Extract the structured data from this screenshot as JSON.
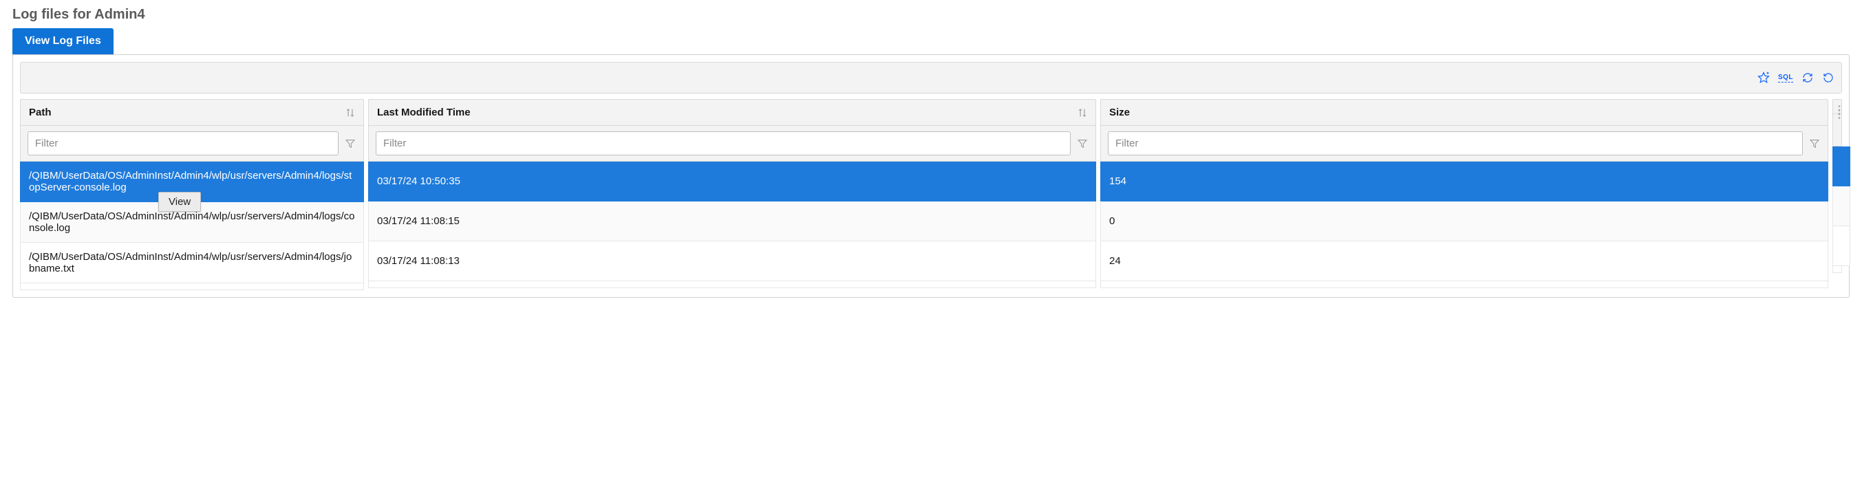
{
  "title": "Log files for Admin4",
  "tabs": {
    "viewLogFiles": "View Log Files"
  },
  "toolbar": {
    "sql": "SQL"
  },
  "columns": {
    "path": "Path",
    "time": "Last Modified Time",
    "size": "Size"
  },
  "filterPlaceholder": "Filter",
  "contextMenu": {
    "view": "View"
  },
  "rows": [
    {
      "path": "/QIBM/UserData/OS/AdminInst/Admin4/wlp/usr/servers/Admin4/logs/stopServer-console.log",
      "time": "03/17/24 10:50:35",
      "size": "154",
      "selected": true
    },
    {
      "path": "/QIBM/UserData/OS/AdminInst/Admin4/wlp/usr/servers/Admin4/logs/console.log",
      "time": "03/17/24 11:08:15",
      "size": "0",
      "selected": false
    },
    {
      "path": "/QIBM/UserData/OS/AdminInst/Admin4/wlp/usr/servers/Admin4/logs/jobname.txt",
      "time": "03/17/24 11:08:13",
      "size": "24",
      "selected": false
    }
  ]
}
